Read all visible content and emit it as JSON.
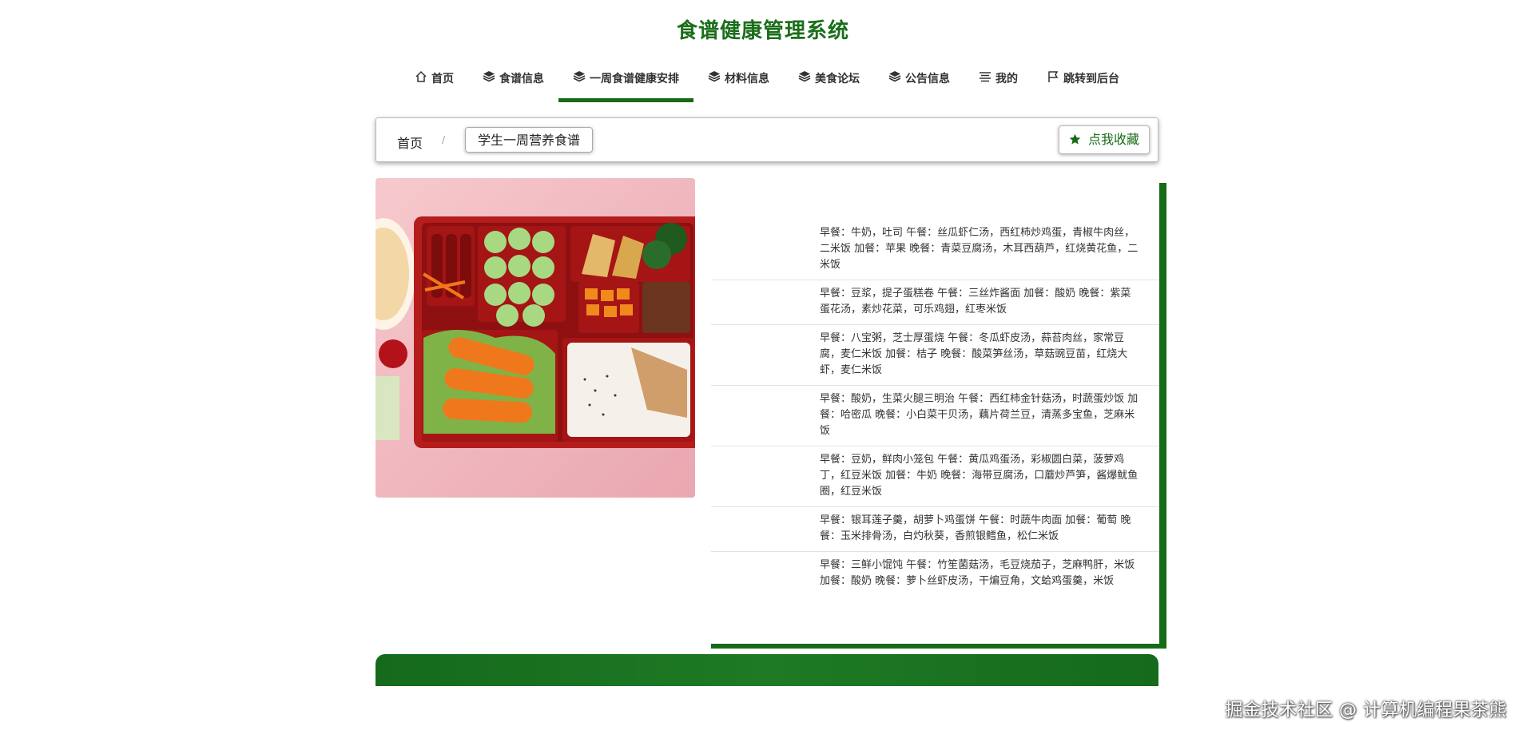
{
  "site": {
    "title": "食谱健康管理系统"
  },
  "nav": {
    "items": [
      {
        "label": "首页",
        "icon": "home-icon"
      },
      {
        "label": "食谱信息",
        "icon": "cube-icon"
      },
      {
        "label": "一周食谱健康安排",
        "icon": "cube-icon",
        "active": true
      },
      {
        "label": "材料信息",
        "icon": "cube-icon"
      },
      {
        "label": "美食论坛",
        "icon": "cube-icon"
      },
      {
        "label": "公告信息",
        "icon": "cube-icon"
      },
      {
        "label": "我的",
        "icon": "list-icon"
      },
      {
        "label": "跳转到后台",
        "icon": "flag-icon"
      }
    ]
  },
  "breadcrumb": {
    "home": "首页",
    "separator": "/",
    "current": "学生一周营养食谱"
  },
  "favorite": {
    "label": "点我收藏",
    "icon": "star-icon"
  },
  "menu": {
    "days": [
      "早餐：牛奶，吐司 午餐：丝瓜虾仁汤，西红柿炒鸡蛋，青椒牛肉丝，二米饭 加餐：苹果 晚餐：青菜豆腐汤，木耳西葫芦，红烧黄花鱼，二米饭",
      "早餐：豆浆，提子蛋糕卷 午餐：三丝炸酱面 加餐：酸奶 晚餐：紫菜蛋花汤，素炒花菜，可乐鸡翅，红枣米饭",
      "早餐：八宝粥，芝士厚蛋烧 午餐：冬瓜虾皮汤，蒜苔肉丝，家常豆腐，麦仁米饭 加餐：桔子 晚餐：酸菜笋丝汤，草菇豌豆苗，红烧大虾，麦仁米饭",
      "早餐：酸奶，生菜火腿三明治 午餐：西红柿金针菇汤，时蔬蛋炒饭 加餐：哈密瓜 晚餐：小白菜干贝汤，藕片荷兰豆，清蒸多宝鱼，芝麻米饭",
      "早餐：豆奶，鲜肉小笼包 午餐：黄瓜鸡蛋汤，彩椒圆白菜，菠萝鸡丁，红豆米饭 加餐：牛奶 晚餐：海带豆腐汤，口蘑炒芦笋，酱爆鱿鱼圈，红豆米饭",
      "早餐：银耳莲子羹，胡萝卜鸡蛋饼 午餐：时蔬牛肉面 加餐：葡萄 晚餐：玉米排骨汤，白灼秋葵，香煎银鳕鱼，松仁米饭",
      "早餐：三鲜小馄饨 午餐：竹笙菌菇汤，毛豆烧茄子，芝麻鸭肝，米饭 加餐：酸奶 晚餐：萝卜丝虾皮汤，干煸豆角，文蛤鸡蛋羹，米饭"
    ]
  },
  "watermark": "掘金技术社区 @ 计算机编程果茶熊",
  "colors": {
    "primary": "#176b17",
    "title": "#1a6e1a"
  }
}
